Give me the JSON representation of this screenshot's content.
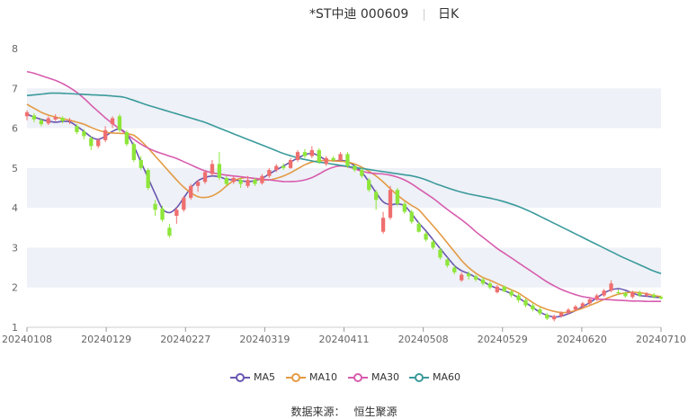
{
  "header": {
    "title": "*ST中迪 000609",
    "period": "日K"
  },
  "source": {
    "label": "数据来源：",
    "name": "恒生聚源"
  },
  "colors": {
    "up": "#ef6f6f",
    "down": "#8ee63a",
    "ma5": "#6a56b0",
    "ma10": "#e39a43",
    "ma30": "#d75cae",
    "ma60": "#3a9a9c",
    "grid_band": "#eef1f7",
    "axis": "#999999"
  },
  "chart_data": {
    "type": "candlestick",
    "x_tick_labels": [
      "20240108",
      "20240129",
      "20240227",
      "20240319",
      "20240411",
      "20240508",
      "20240529",
      "20240620",
      "20240710"
    ],
    "ylim": [
      1,
      8
    ],
    "y_ticks": [
      1,
      2,
      3,
      4,
      5,
      6,
      7,
      8
    ],
    "legend_position": "bottom",
    "series": [
      {
        "name": "MA5",
        "color_key": "ma5",
        "values": [
          6.35,
          6.28,
          6.22,
          6.18,
          6.15,
          6.17,
          6.16,
          6.05,
          5.92,
          5.78,
          5.72,
          5.8,
          5.92,
          5.98,
          5.85,
          5.55,
          5.15,
          4.75,
          4.35,
          3.98,
          3.88,
          4.0,
          4.25,
          4.5,
          4.68,
          4.76,
          4.8,
          4.78,
          4.72,
          4.7,
          4.68,
          4.66,
          4.68,
          4.74,
          4.85,
          4.95,
          5.05,
          5.15,
          5.25,
          5.33,
          5.37,
          5.3,
          5.2,
          5.18,
          5.19,
          5.16,
          5.05,
          4.9,
          4.65,
          4.38,
          4.15,
          4.08,
          4.1,
          4.05,
          3.85,
          3.62,
          3.42,
          3.2,
          2.98,
          2.76,
          2.55,
          2.42,
          2.35,
          2.25,
          2.15,
          2.05,
          1.98,
          1.92,
          1.84,
          1.74,
          1.62,
          1.5,
          1.38,
          1.3,
          1.26,
          1.28,
          1.34,
          1.42,
          1.52,
          1.62,
          1.74,
          1.86,
          1.94,
          1.97,
          1.93,
          1.86,
          1.8,
          1.78,
          1.76,
          1.74
        ]
      },
      {
        "name": "MA10",
        "color_key": "ma10",
        "values": [
          6.6,
          6.5,
          6.4,
          6.33,
          6.28,
          6.24,
          6.2,
          6.15,
          6.1,
          6.02,
          5.95,
          5.9,
          5.88,
          5.87,
          5.86,
          5.82,
          5.68,
          5.5,
          5.3,
          5.1,
          4.9,
          4.7,
          4.52,
          4.38,
          4.28,
          4.26,
          4.3,
          4.4,
          4.55,
          4.68,
          4.74,
          4.76,
          4.73,
          4.7,
          4.7,
          4.74,
          4.8,
          4.88,
          4.98,
          5.08,
          5.15,
          5.18,
          5.19,
          5.18,
          5.17,
          5.15,
          5.1,
          5.02,
          4.92,
          4.8,
          4.65,
          4.48,
          4.32,
          4.18,
          4.06,
          3.95,
          3.75,
          3.55,
          3.34,
          3.12,
          2.9,
          2.68,
          2.5,
          2.36,
          2.25,
          2.18,
          2.1,
          2.02,
          1.94,
          1.86,
          1.74,
          1.62,
          1.52,
          1.45,
          1.4,
          1.37,
          1.38,
          1.42,
          1.48,
          1.55,
          1.62,
          1.7,
          1.77,
          1.83,
          1.86,
          1.88,
          1.87,
          1.84,
          1.8,
          1.77
        ]
      },
      {
        "name": "MA30",
        "color_key": "ma30",
        "values": [
          7.42,
          7.38,
          7.32,
          7.26,
          7.2,
          7.12,
          7.02,
          6.9,
          6.75,
          6.58,
          6.42,
          6.26,
          6.12,
          5.98,
          5.85,
          5.72,
          5.6,
          5.5,
          5.42,
          5.36,
          5.3,
          5.24,
          5.16,
          5.08,
          5.0,
          4.93,
          4.88,
          4.85,
          4.82,
          4.8,
          4.78,
          4.76,
          4.74,
          4.72,
          4.7,
          4.68,
          4.66,
          4.66,
          4.67,
          4.7,
          4.76,
          4.85,
          4.95,
          5.02,
          5.05,
          5.03,
          4.98,
          4.92,
          4.88,
          4.86,
          4.85,
          4.82,
          4.77,
          4.7,
          4.6,
          4.48,
          4.36,
          4.24,
          4.1,
          3.96,
          3.83,
          3.7,
          3.56,
          3.4,
          3.26,
          3.12,
          2.98,
          2.86,
          2.74,
          2.62,
          2.5,
          2.38,
          2.26,
          2.14,
          2.04,
          1.95,
          1.88,
          1.82,
          1.77,
          1.74,
          1.71,
          1.7,
          1.69,
          1.68,
          1.67,
          1.66,
          1.66,
          1.65,
          1.65,
          1.65
        ]
      },
      {
        "name": "MA60",
        "color_key": "ma60",
        "values": [
          6.82,
          6.84,
          6.86,
          6.88,
          6.88,
          6.87,
          6.86,
          6.85,
          6.84,
          6.83,
          6.82,
          6.8,
          6.78,
          6.72,
          6.65,
          6.58,
          6.52,
          6.46,
          6.4,
          6.34,
          6.28,
          6.22,
          6.16,
          6.08,
          6.0,
          5.92,
          5.84,
          5.76,
          5.68,
          5.6,
          5.52,
          5.44,
          5.36,
          5.3,
          5.24,
          5.2,
          5.16,
          5.13,
          5.1,
          5.07,
          5.04,
          5.01,
          4.98,
          4.95,
          4.92,
          4.89,
          4.86,
          4.83,
          4.8,
          4.75,
          4.68,
          4.6,
          4.53,
          4.46,
          4.4,
          4.35,
          4.31,
          4.27,
          4.23,
          4.18,
          4.12,
          4.05,
          3.97,
          3.88,
          3.78,
          3.68,
          3.58,
          3.48,
          3.38,
          3.28,
          3.18,
          3.08,
          2.98,
          2.88,
          2.78,
          2.69,
          2.6,
          2.51,
          2.42,
          2.35
        ]
      }
    ],
    "candles": [
      [
        6.3,
        6.4,
        6.45,
        6.2
      ],
      [
        6.32,
        6.22,
        6.38,
        6.15
      ],
      [
        6.2,
        6.1,
        6.25,
        6.05
      ],
      [
        6.12,
        6.25,
        6.3,
        6.08
      ],
      [
        6.22,
        6.28,
        6.35,
        6.18
      ],
      [
        6.26,
        6.18,
        6.3,
        6.12
      ],
      [
        6.18,
        6.2,
        6.26,
        6.1
      ],
      [
        6.05,
        5.9,
        6.1,
        5.85
      ],
      [
        5.92,
        5.8,
        5.98,
        5.72
      ],
      [
        5.75,
        5.55,
        5.8,
        5.45
      ],
      [
        5.55,
        5.7,
        5.75,
        5.5
      ],
      [
        5.7,
        5.95,
        6.05,
        5.65
      ],
      [
        6.1,
        6.25,
        6.3,
        6.0
      ],
      [
        6.3,
        5.95,
        6.35,
        5.9
      ],
      [
        5.9,
        5.6,
        5.95,
        5.55
      ],
      [
        5.6,
        5.2,
        5.65,
        5.15
      ],
      [
        5.2,
        5.0,
        5.3,
        4.95
      ],
      [
        4.95,
        4.5,
        5.0,
        4.45
      ],
      [
        4.1,
        3.95,
        4.2,
        3.8
      ],
      [
        3.98,
        3.7,
        4.05,
        3.65
      ],
      [
        3.5,
        3.3,
        3.6,
        3.25
      ],
      [
        3.8,
        3.95,
        4.0,
        3.6
      ],
      [
        3.95,
        4.25,
        4.3,
        3.9
      ],
      [
        4.25,
        4.55,
        4.6,
        4.2
      ],
      [
        4.55,
        4.65,
        4.7,
        4.4
      ],
      [
        4.65,
        4.9,
        4.95,
        4.6
      ],
      [
        4.85,
        5.1,
        5.2,
        4.8
      ],
      [
        5.1,
        4.75,
        5.4,
        4.7
      ],
      [
        4.75,
        4.6,
        4.8,
        4.55
      ],
      [
        4.65,
        4.75,
        4.8,
        4.6
      ],
      [
        4.7,
        4.6,
        4.75,
        4.5
      ],
      [
        4.55,
        4.7,
        4.8,
        4.5
      ],
      [
        4.7,
        4.6,
        4.75,
        4.55
      ],
      [
        4.62,
        4.8,
        4.85,
        4.58
      ],
      [
        4.8,
        4.95,
        5.0,
        4.75
      ],
      [
        4.95,
        5.05,
        5.1,
        4.9
      ],
      [
        5.05,
        5.0,
        5.12,
        4.95
      ],
      [
        5.0,
        5.2,
        5.25,
        4.98
      ],
      [
        5.2,
        5.4,
        5.45,
        5.15
      ],
      [
        5.4,
        5.3,
        5.48,
        5.25
      ],
      [
        5.3,
        5.45,
        5.55,
        5.25
      ],
      [
        5.45,
        5.15,
        5.5,
        5.1
      ],
      [
        5.1,
        5.25,
        5.3,
        5.05
      ],
      [
        5.25,
        5.2,
        5.3,
        5.15
      ],
      [
        5.2,
        5.35,
        5.4,
        5.15
      ],
      [
        5.35,
        5.05,
        5.4,
        5.0
      ],
      [
        5.05,
        4.95,
        5.1,
        4.9
      ],
      [
        4.95,
        4.8,
        5.0,
        4.75
      ],
      [
        4.7,
        4.45,
        4.75,
        4.4
      ],
      [
        4.4,
        4.2,
        4.45,
        3.95
      ],
      [
        3.4,
        3.75,
        3.9,
        3.35
      ],
      [
        3.75,
        4.45,
        4.55,
        3.7
      ],
      [
        4.45,
        4.1,
        4.5,
        4.05
      ],
      [
        4.1,
        3.9,
        4.15,
        3.85
      ],
      [
        3.9,
        3.65,
        3.95,
        3.6
      ],
      [
        3.6,
        3.4,
        3.65,
        3.38
      ],
      [
        3.35,
        3.2,
        3.4,
        3.15
      ],
      [
        3.15,
        3.0,
        3.2,
        2.95
      ],
      [
        2.95,
        2.75,
        3.0,
        2.7
      ],
      [
        2.7,
        2.55,
        2.75,
        2.5
      ],
      [
        2.5,
        2.38,
        2.55,
        2.33
      ],
      [
        2.18,
        2.32,
        2.38,
        2.14
      ],
      [
        2.35,
        2.28,
        2.4,
        2.2
      ],
      [
        2.28,
        2.2,
        2.32,
        2.15
      ],
      [
        2.2,
        2.1,
        2.25,
        2.05
      ],
      [
        2.1,
        2.0,
        2.15,
        1.95
      ],
      [
        1.88,
        2.02,
        2.06,
        1.85
      ],
      [
        2.02,
        1.9,
        2.05,
        1.88
      ],
      [
        1.9,
        1.8,
        1.95,
        1.75
      ],
      [
        1.8,
        1.68,
        1.85,
        1.62
      ],
      [
        1.68,
        1.55,
        1.72,
        1.5
      ],
      [
        1.55,
        1.45,
        1.6,
        1.4
      ],
      [
        1.45,
        1.35,
        1.5,
        1.3
      ],
      [
        1.32,
        1.22,
        1.36,
        1.18
      ],
      [
        1.2,
        1.28,
        1.32,
        1.15
      ],
      [
        1.28,
        1.36,
        1.4,
        1.24
      ],
      [
        1.36,
        1.44,
        1.48,
        1.32
      ],
      [
        1.44,
        1.52,
        1.56,
        1.4
      ],
      [
        1.52,
        1.6,
        1.64,
        1.48
      ],
      [
        1.6,
        1.7,
        1.74,
        1.56
      ],
      [
        1.7,
        1.8,
        1.84,
        1.66
      ],
      [
        1.8,
        1.92,
        1.96,
        1.76
      ],
      [
        1.92,
        2.1,
        2.18,
        1.88
      ],
      [
        1.88,
        1.86,
        1.95,
        1.82
      ],
      [
        1.86,
        1.78,
        1.9,
        1.74
      ],
      [
        1.76,
        1.88,
        1.92,
        1.72
      ],
      [
        1.86,
        1.8,
        1.92,
        1.76
      ],
      [
        1.8,
        1.85,
        1.88,
        1.76
      ],
      [
        1.82,
        1.76,
        1.86,
        1.72
      ],
      [
        1.76,
        1.72,
        1.8,
        1.7
      ]
    ]
  }
}
